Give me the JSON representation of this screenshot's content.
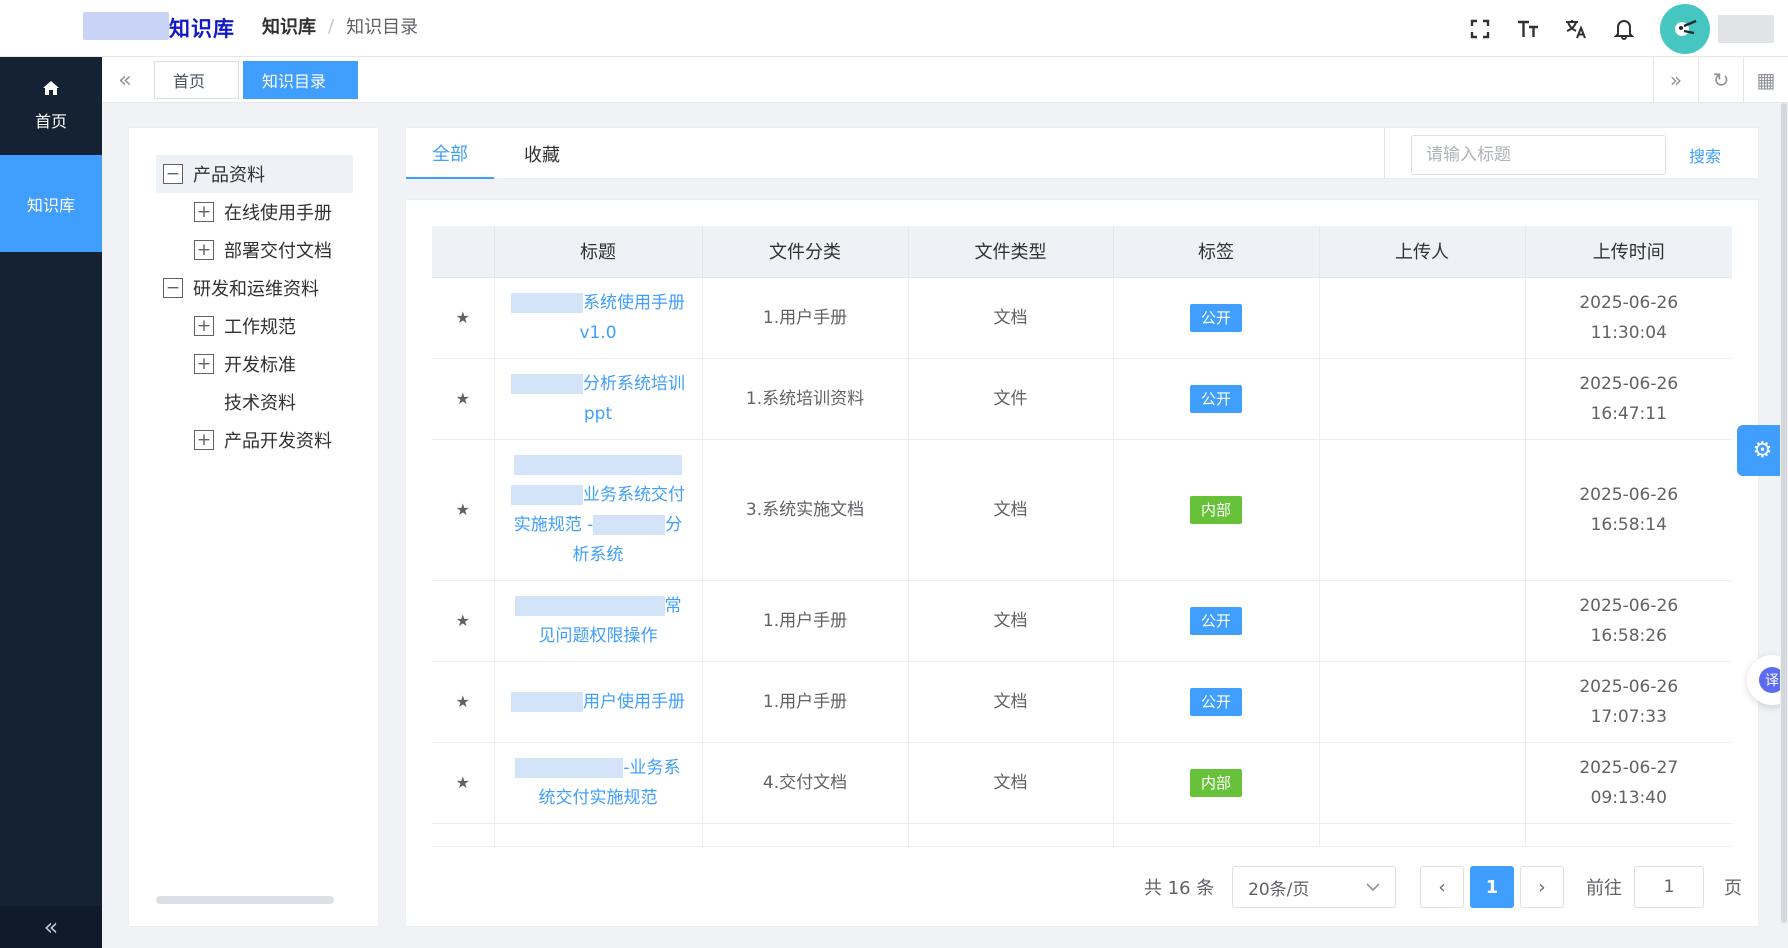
{
  "brand": {
    "title": "知识库"
  },
  "breadcrumb": {
    "root": "知识库",
    "separator": "/",
    "current": "知识目录"
  },
  "topbar": {
    "icons": [
      "fullscreen-icon",
      "font-size-icon",
      "translate-icon",
      "bell-icon"
    ]
  },
  "sidebar": {
    "home_label": "首页",
    "kb_label": "知识库",
    "collapse_glyph": "«"
  },
  "tags": {
    "left_glyph": "«",
    "home": "首页",
    "active": "知识目录",
    "right_glyph": "»",
    "refresh_glyph": "↻",
    "grid_glyph": "▦"
  },
  "tree": {
    "nodes": [
      {
        "label": "产品资料",
        "toggle": "−"
      },
      {
        "label": "在线使用手册",
        "toggle": "+"
      },
      {
        "label": "部署交付文档",
        "toggle": "+"
      },
      {
        "label": "研发和运维资料",
        "toggle": "−"
      },
      {
        "label": "工作规范",
        "toggle": "+"
      },
      {
        "label": "开发标准",
        "toggle": "+"
      },
      {
        "label": "技术资料"
      },
      {
        "label": "产品开发资料",
        "toggle": "+"
      }
    ]
  },
  "tabs": {
    "all": "全部",
    "favorites": "收藏"
  },
  "search": {
    "placeholder": "请输入标题",
    "button": "搜索"
  },
  "table": {
    "headers": [
      "标题",
      "文件分类",
      "文件类型",
      "标签",
      "上传人",
      "上传时间"
    ],
    "star_glyph": "★",
    "rows": [
      {
        "title": "系统使用手册v1.0",
        "category": "1.用户手册",
        "type": "文档",
        "tag": "公开",
        "uploader": "",
        "time": "2025-06-26 11:30:04"
      },
      {
        "title": "分析系统培训ppt",
        "category": "1.系统培训资料",
        "type": "文件",
        "tag": "公开",
        "uploader": "",
        "time": "2025-06-26 16:47:11"
      },
      {
        "title": "业务系统交付实施规范 -",
        "title_suffix": "分析系统",
        "category": "3.系统实施文档",
        "type": "文档",
        "tag": "内部",
        "uploader": "",
        "time": "2025-06-26 16:58:14"
      },
      {
        "title": "常见问题权限操作",
        "category": "1.用户手册",
        "type": "文档",
        "tag": "公开",
        "uploader": "",
        "time": "2025-06-26 16:58:26"
      },
      {
        "title": "用户使用手册",
        "category": "1.用户手册",
        "type": "文档",
        "tag": "公开",
        "uploader": "",
        "time": "2025-06-26 17:07:33"
      },
      {
        "title": "-业务系统交付实施规范",
        "category": "4.交付文档",
        "type": "文档",
        "tag": "内部",
        "uploader": "",
        "time": "2025-06-27 09:13:40"
      }
    ]
  },
  "pagination": {
    "total": "共 16 条",
    "page_size": "20条/页",
    "prev_glyph": "‹",
    "page": "1",
    "next_glyph": "›",
    "goto_label": "前往",
    "goto_value": "1",
    "goto_suffix": "页"
  },
  "floating": {
    "settings_glyph": "⚙",
    "translate_label": "译"
  },
  "colors": {
    "primary": "#409eff",
    "sidebar": "#142233",
    "tag_public": "#409eff",
    "tag_internal": "#67c23a"
  }
}
